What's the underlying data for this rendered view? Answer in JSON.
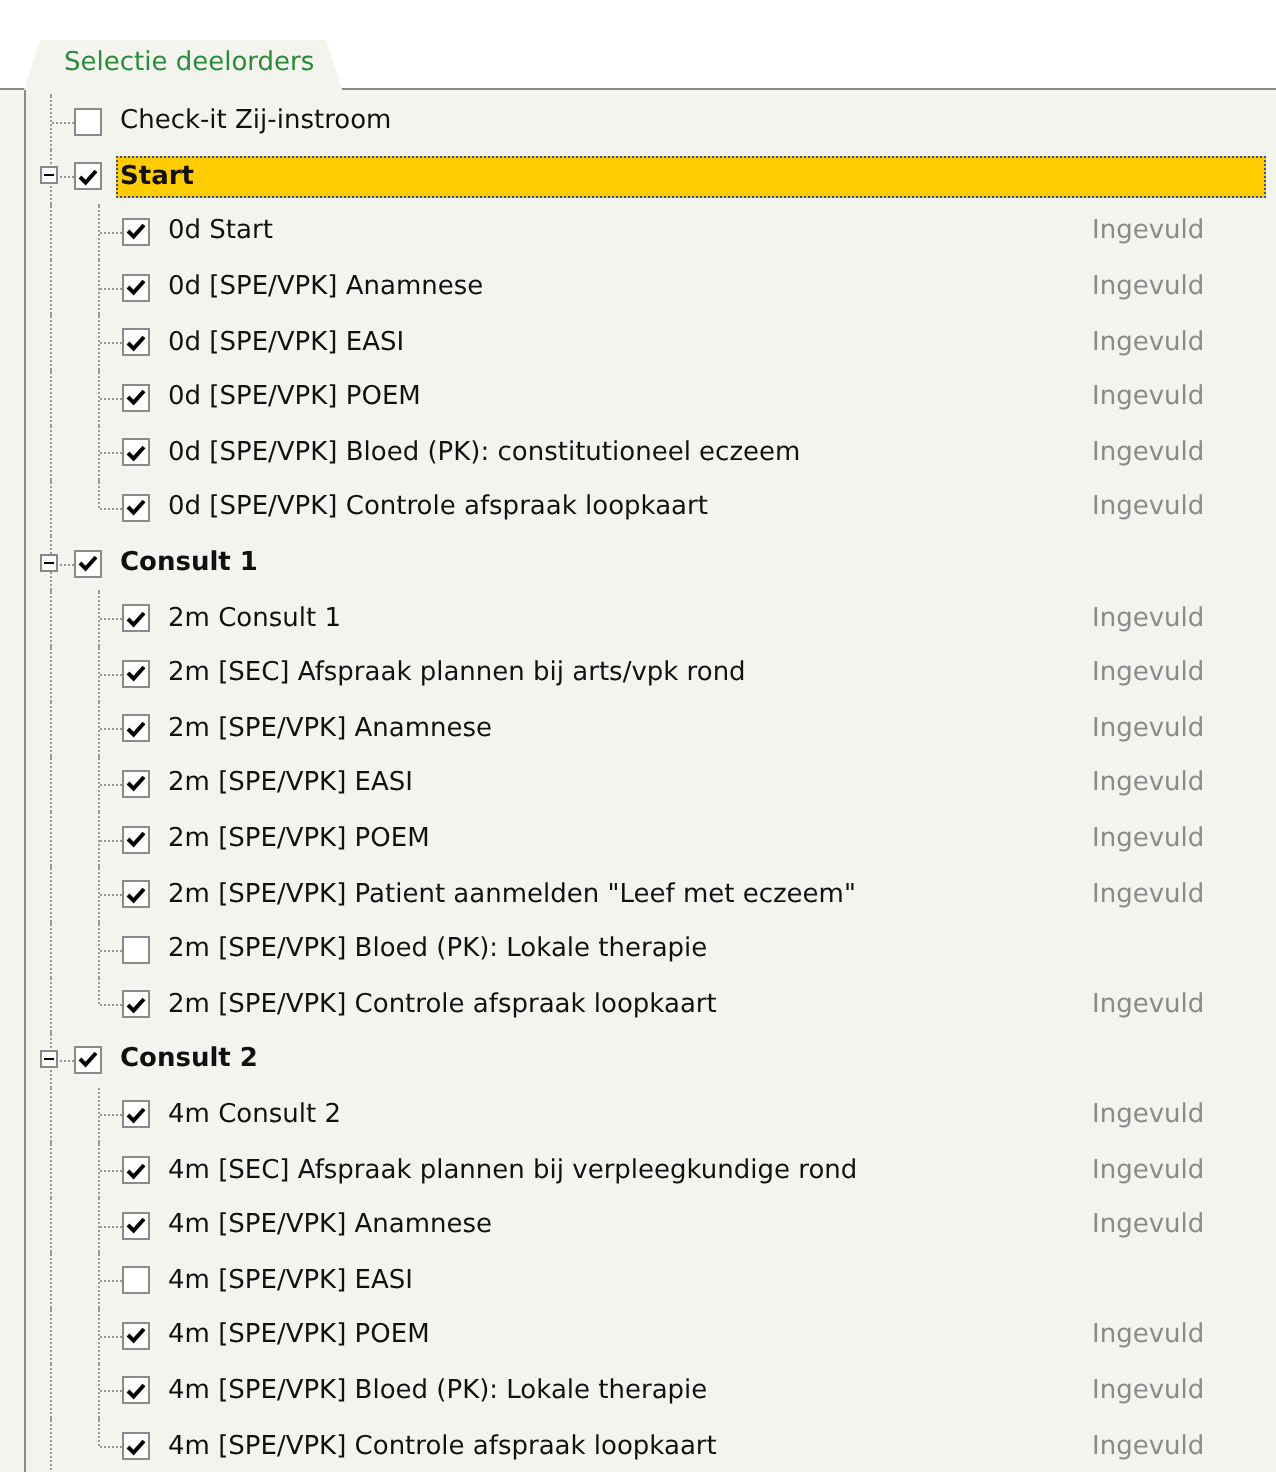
{
  "tabs": [
    {
      "label": "Selectie deelorders",
      "selected": true
    }
  ],
  "tree": [
    {
      "kind": "item",
      "label": "Check-it Zij-instroom",
      "checked": false
    },
    {
      "kind": "group",
      "label": "Start",
      "checked": true,
      "expanded": true,
      "selected": true,
      "children": [
        {
          "label": "0d Start",
          "checked": true,
          "status": "Ingevuld"
        },
        {
          "label": "0d [SPE/VPK] Anamnese",
          "checked": true,
          "status": "Ingevuld"
        },
        {
          "label": "0d [SPE/VPK] EASI",
          "checked": true,
          "status": "Ingevuld"
        },
        {
          "label": "0d [SPE/VPK] POEM",
          "checked": true,
          "status": "Ingevuld"
        },
        {
          "label": "0d [SPE/VPK] Bloed (PK): constitutioneel eczeem",
          "checked": true,
          "status": "Ingevuld"
        },
        {
          "label": "0d [SPE/VPK] Controle afspraak loopkaart",
          "checked": true,
          "status": "Ingevuld"
        }
      ]
    },
    {
      "kind": "group",
      "label": "Consult 1",
      "checked": true,
      "expanded": true,
      "selected": false,
      "children": [
        {
          "label": "2m Consult 1",
          "checked": true,
          "status": "Ingevuld"
        },
        {
          "label": "2m [SEC] Afspraak plannen bij arts/vpk rond",
          "checked": true,
          "status": "Ingevuld"
        },
        {
          "label": "2m [SPE/VPK] Anamnese",
          "checked": true,
          "status": "Ingevuld"
        },
        {
          "label": "2m [SPE/VPK] EASI",
          "checked": true,
          "status": "Ingevuld"
        },
        {
          "label": "2m [SPE/VPK] POEM",
          "checked": true,
          "status": "Ingevuld"
        },
        {
          "label": "2m [SPE/VPK] Patient aanmelden \"Leef met eczeem\"",
          "checked": true,
          "status": "Ingevuld"
        },
        {
          "label": "2m [SPE/VPK] Bloed (PK): Lokale therapie",
          "checked": false
        },
        {
          "label": "2m [SPE/VPK] Controle afspraak loopkaart",
          "checked": true,
          "status": "Ingevuld"
        }
      ]
    },
    {
      "kind": "group",
      "label": "Consult 2",
      "checked": true,
      "expanded": true,
      "selected": false,
      "children": [
        {
          "label": "4m Consult 2",
          "checked": true,
          "status": "Ingevuld"
        },
        {
          "label": "4m [SEC] Afspraak plannen bij verpleegkundige rond",
          "checked": true,
          "status": "Ingevuld"
        },
        {
          "label": "4m [SPE/VPK] Anamnese",
          "checked": true,
          "status": "Ingevuld"
        },
        {
          "label": "4m [SPE/VPK] EASI",
          "checked": false
        },
        {
          "label": "4m [SPE/VPK] POEM",
          "checked": true,
          "status": "Ingevuld"
        },
        {
          "label": "4m [SPE/VPK] Bloed (PK): Lokale therapie",
          "checked": true,
          "status": "Ingevuld"
        },
        {
          "label": "4m [SPE/VPK] Controle afspraak loopkaart",
          "checked": true,
          "status": "Ingevuld"
        }
      ]
    }
  ]
}
